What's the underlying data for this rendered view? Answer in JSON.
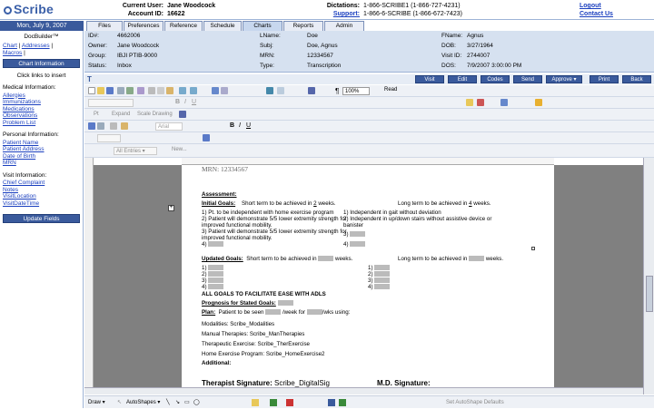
{
  "header": {
    "logo_text": "Scribe",
    "current_user_label": "Current User:",
    "current_user": "Jane Woodcock",
    "account_label": "Account ID:",
    "account_id": "16622",
    "dictations_label": "Dictations:",
    "dictations_value": "1-866-SCRIBE1 (1-866-727-4231)",
    "support_label": "Support:",
    "support_value": "1-866-6-SCRIBE (1-866-672-7423)",
    "logout": "Logout",
    "contact": "Contact Us"
  },
  "date_bar": "Mon, July 9, 2007",
  "tabs": [
    "Files",
    "Preferences",
    "Reference",
    "Schedule",
    "Charts",
    "Reports",
    "Admin"
  ],
  "active_tab": "Charts",
  "left": {
    "docbuilder": "DocBuilder™",
    "links": [
      "Chart",
      "Addresses",
      "Macros"
    ],
    "chart_info_btn": "Chart Information",
    "hint": "Click links to insert",
    "medical_heading": "Medical Information:",
    "medical_links": [
      "Allergies",
      "Immunizations",
      "Medications",
      "Observations",
      "Problem List"
    ],
    "personal_heading": "Personal Information:",
    "personal_links": [
      "Patient Name",
      "Patient Address",
      "Date of Birth",
      "MRN"
    ],
    "visit_heading": "Visit Information:",
    "visit_links": [
      "Chief Complaint",
      "Notes",
      "VisitLocation",
      "VisitDateTime"
    ],
    "update_btn": "Update Fields"
  },
  "info": {
    "id_label": "ID#:",
    "id": "4662006",
    "owner_label": "Owner:",
    "owner": "Jane Woodcock",
    "group_label": "Group:",
    "group": "IBJI PTIB-9000",
    "status_label": "Status:",
    "status": "Inbox",
    "lname_label": "LName:",
    "lname": "Doe",
    "subj_label": "Subj:",
    "subj": "Doe, Agnus",
    "mrn_label": "MRN:",
    "mrn": "12334567",
    "type_label": "Type:",
    "type": "Transcription",
    "fname_label": "FName:",
    "fname": "Agnus",
    "dob_label": "DOB:",
    "dob": "3/27/1964",
    "visit_label": "Visit ID:",
    "visit": "2744007",
    "dos_label": "DOS:",
    "dos": "7/9/2007 3:00:00 PM"
  },
  "actions": [
    "Visit",
    "Edit",
    "Codes",
    "Send",
    "Approve ▾",
    "Print",
    "Back"
  ],
  "toolbar": {
    "zoom": "100%",
    "read": "Read",
    "expand": "Expand",
    "scale": "Scale Drawing",
    "font": "Arial",
    "all_entries": "All Entries ▾",
    "new": "New..."
  },
  "doc": {
    "mrn_line": "MRN: 12334567",
    "assessment": "Assessment:",
    "initial_goals": "Initial Goals:",
    "short_term": "Short term to be achieved in",
    "short_weeks": "2",
    "weeks": "weeks.",
    "long_term": "Long term to be achieved in",
    "long_weeks": "4",
    "goal1": "1)  Pt. to be independent with home exercise program",
    "goal2a": "2)  Patient will demonstrate 5/5 lower extremity strength for",
    "goal2b": "improved functional mobility.",
    "goal3a": "3)  Patient will demonstrate 5/5 lower extremity strength for",
    "goal3b": "improved functional mobility.",
    "goal4": "4)",
    "lgoal1": "1)  Independent in gait without deviation",
    "lgoal2a": "2)  Independent in up/down stairs without assistive device or",
    "lgoal2b": "banister",
    "lgoal3": "3)",
    "lgoal4": "4)",
    "updated_goals": "Updated Goals:",
    "num1": "1)",
    "num2": "2)",
    "num3": "3)",
    "num4": "4)",
    "all_goals": "ALL GOALS TO FACILITATE EASE WITH ADLS",
    "prognosis": "Prognosis for Stated Goals:",
    "plan": "Plan:",
    "plan_text": "Patient to be seen",
    "per_week": "/week for",
    "wks_using": "/wks using:",
    "modalities": "Modalities:  Scribe_Modalities",
    "manual": "Manual Therapies:  Scribe_ManTherapies",
    "therapeutic": "Therapeutic Exercise:  Scribe_TherExercise",
    "home": "Home Exercise Program:  Scribe_HomeExercise2",
    "additional": "Additional:",
    "therapist_sig": "Therapist Signature:",
    "therapist_val": "Scribe_DigitalSig",
    "md_sig": "M.D. Signature:"
  },
  "drawbar": {
    "draw": "Draw ▾",
    "autoshapes": "AutoShapes ▾",
    "set_default": "Set AutoShape Defaults"
  }
}
